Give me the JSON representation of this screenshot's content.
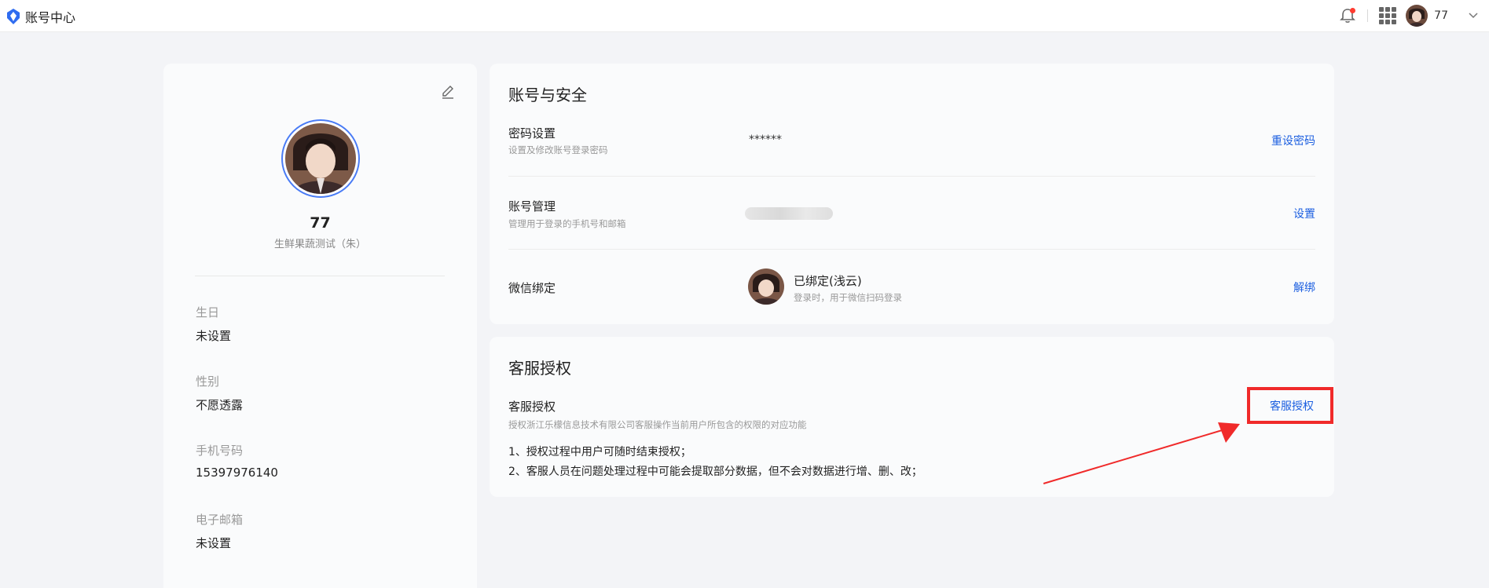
{
  "header": {
    "title": "账号中心",
    "user_name": "77",
    "logo_icon": "shield-logo-icon",
    "notification_icon": "bell-icon",
    "apps_icon": "grid-apps-icon",
    "accent": "#1c5fe0"
  },
  "profile": {
    "name": "77",
    "company": "生鲜果蔬测试（朱）",
    "fields": [
      {
        "label": "生日",
        "value": "未设置"
      },
      {
        "label": "性别",
        "value": "不愿透露"
      },
      {
        "label": "手机号码",
        "value": "15397976140"
      },
      {
        "label": "电子邮箱",
        "value": "未设置"
      }
    ]
  },
  "security": {
    "title": "账号与安全",
    "password": {
      "title": "密码设置",
      "subtitle": "设置及修改账号登录密码",
      "value": "******",
      "action": "重设密码"
    },
    "account": {
      "title": "账号管理",
      "subtitle": "管理用于登录的手机号和邮箱",
      "action": "设置"
    },
    "wechat": {
      "title": "微信绑定",
      "status": "已绑定(浅云)",
      "subtitle": "登录时，用于微信扫码登录",
      "action": "解绑"
    }
  },
  "auth": {
    "title": "客服授权",
    "row_title": "客服授权",
    "subtitle": "授权浙江乐檬信息技术有限公司客服操作当前用户所包含的权限的对应功能",
    "notes": [
      "1、授权过程中用户可随时结束授权；",
      "2、客服人员在问题处理过程中可能会提取部分数据，但不会对数据进行增、删、改；"
    ],
    "action": "客服授权",
    "highlight_color": "#f02a2a"
  }
}
